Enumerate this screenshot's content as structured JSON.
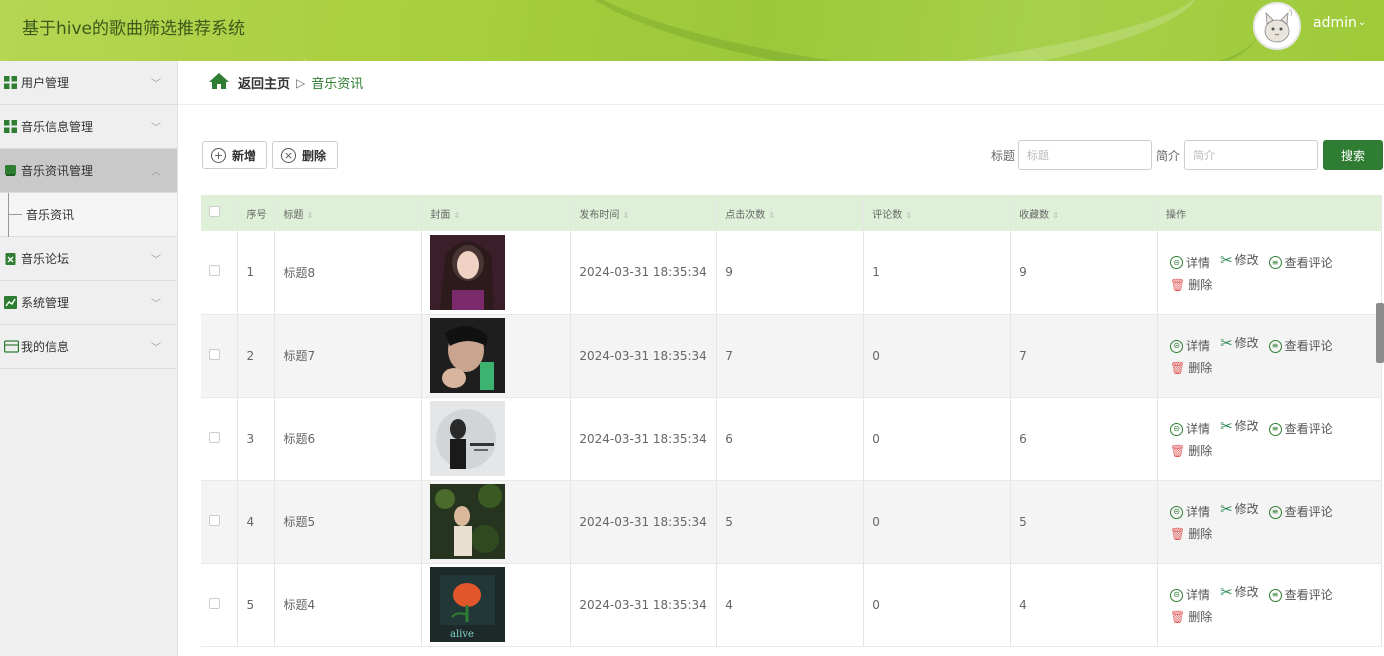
{
  "app": {
    "title": "基于hive的歌曲筛选推荐系统",
    "user": "admin",
    "user_caret": "⌄"
  },
  "sidebar": {
    "items": [
      {
        "label": "用户管理",
        "icon": "grid-icon"
      },
      {
        "label": "音乐信息管理",
        "icon": "grid-icon"
      },
      {
        "label": "音乐资讯管理",
        "icon": "book-icon",
        "expanded": true
      },
      {
        "label": "音乐论坛",
        "icon": "clipboard-icon"
      },
      {
        "label": "系统管理",
        "icon": "chart-icon"
      },
      {
        "label": "我的信息",
        "icon": "card-icon"
      }
    ],
    "sub_item": "音乐资讯"
  },
  "breadcrumb": {
    "home": "返回主页",
    "separator": "▷",
    "current": "音乐资讯"
  },
  "toolbar": {
    "add": "新增",
    "delete": "删除"
  },
  "search": {
    "title_label": "标题",
    "title_placeholder": "标题",
    "intro_label": "简介",
    "intro_placeholder": "简介",
    "button": "搜索"
  },
  "table": {
    "headers": [
      "序号",
      "标题",
      "封面",
      "发布时间",
      "点击次数",
      "评论数",
      "收藏数",
      "操作"
    ],
    "rows": [
      {
        "no": "1",
        "title": "标题8",
        "time": "2024-03-31 18:35:34",
        "clicks": "9",
        "comments": "1",
        "favorites": "9"
      },
      {
        "no": "2",
        "title": "标题7",
        "time": "2024-03-31 18:35:34",
        "clicks": "7",
        "comments": "0",
        "favorites": "7"
      },
      {
        "no": "3",
        "title": "标题6",
        "time": "2024-03-31 18:35:34",
        "clicks": "6",
        "comments": "0",
        "favorites": "6"
      },
      {
        "no": "4",
        "title": "标题5",
        "time": "2024-03-31 18:35:34",
        "clicks": "5",
        "comments": "0",
        "favorites": "5"
      },
      {
        "no": "5",
        "title": "标题4",
        "time": "2024-03-31 18:35:34",
        "clicks": "4",
        "comments": "0",
        "favorites": "4"
      }
    ],
    "actions": {
      "detail": "详情",
      "edit": "修改",
      "comments": "查看评论",
      "delete": "删除"
    }
  },
  "colors": {
    "accent": "#2e7d32",
    "header_green": "#a6d04a",
    "table_header": "#dff0d8"
  }
}
